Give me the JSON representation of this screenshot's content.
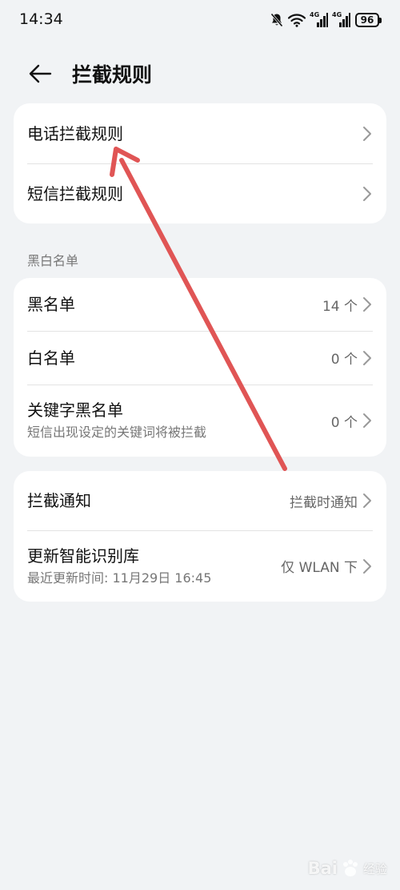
{
  "status_bar": {
    "time": "14:34",
    "signal_1_label": "4G",
    "signal_2_label": "4G",
    "battery": "96"
  },
  "header": {
    "title": "拦截规则"
  },
  "rules_card": {
    "items": [
      {
        "label": "电话拦截规则"
      },
      {
        "label": "短信拦截规则"
      }
    ]
  },
  "lists_section": {
    "label": "黑白名单",
    "items": [
      {
        "label": "黑名单",
        "value": "14 个"
      },
      {
        "label": "白名单",
        "value": "0 个"
      },
      {
        "label": "关键字黑名单",
        "sublabel": "短信出现设定的关键词将被拦截",
        "value": "0 个"
      }
    ]
  },
  "settings_card": {
    "items": [
      {
        "label": "拦截通知",
        "value": "拦截时通知"
      },
      {
        "label": "更新智能识别库",
        "sublabel": "最近更新时间: 11月29日 16:45",
        "value": "仅 WLAN 下"
      }
    ]
  },
  "watermark": {
    "brand": "Bai",
    "suffix": "经验"
  },
  "colors": {
    "background": "#f1f3f5",
    "card": "#ffffff",
    "annotation_arrow": "#e05555"
  }
}
